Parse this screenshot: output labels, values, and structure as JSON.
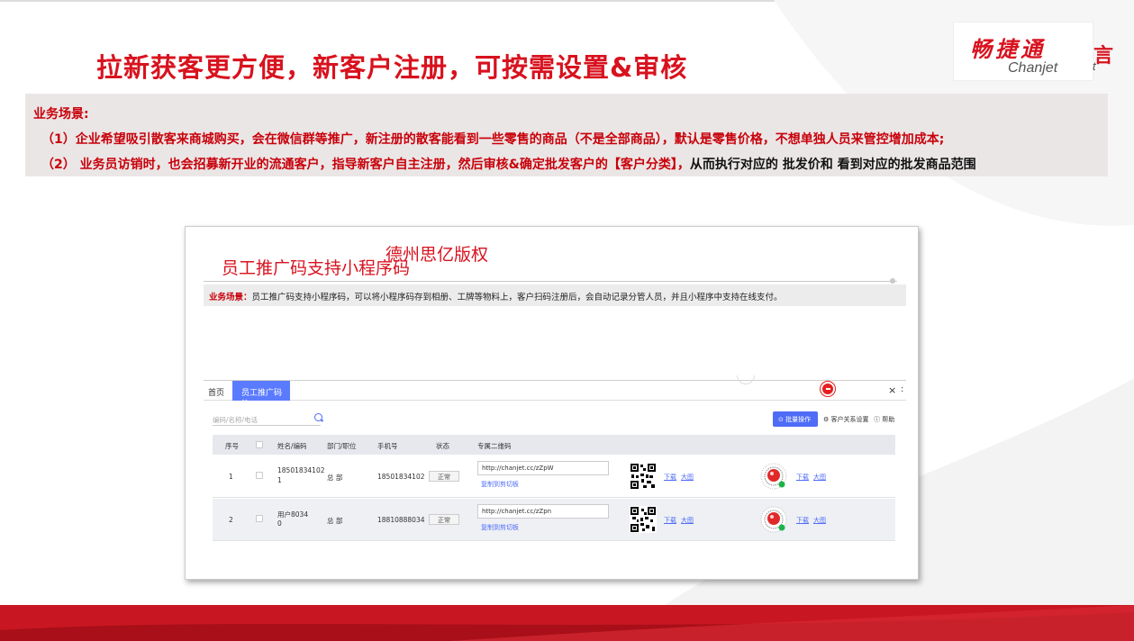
{
  "slide": {
    "title": "拉新获客更方便，新客户注册，可按需设置&审核",
    "colors": {
      "brand_red": "#d8121e",
      "scenario_bg": "#ebe6e6",
      "accent_blue": "#4f6cf7"
    }
  },
  "logo": {
    "cn": "畅捷通",
    "en": "Chanjet",
    "edge_cn": "言",
    "edge_en": "t"
  },
  "scenario": {
    "heading": "业务场景:",
    "line1": "（1）企业希望吸引散客来商城购买，会在微信群等推广，新注册的散客能看到一些零售的商品（不是全部商品），默认是零售价格，不想单独人员来管控增加成本;",
    "line2_red": "（2） 业务员访销时，也会招募新开业的流通客户，指导新客户自主注册，然后审核&确定批发客户的【客户分类】，",
    "line2_black": "从而执行对应的 批发价和 看到对应的批发商品范围"
  },
  "screenshot": {
    "title": "员工推广码支持小程序码",
    "watermark": "德州思亿版权",
    "bar_label": "业务场景：",
    "bar_text": "员工推广码支持小程序码，可以将小程序码存到相册、工牌等物料上，客户扫码注册后，会自动记录分管人员，并且小程序中支持在线支付。",
    "app": {
      "tabs": {
        "home": "首页",
        "active": "员工推广码 ×",
        "close": "×",
        "more": ":"
      },
      "search_placeholder": "编码/名称/电话",
      "batch_button": "批量操作",
      "relation_settings": "客户关系设置",
      "help": "帮助",
      "columns": [
        "序号",
        "",
        "姓名/编码",
        "部门/职位",
        "手机号",
        "状态",
        "专属二维码"
      ],
      "rows": [
        {
          "index": "1",
          "name_line1": "18501834102",
          "name_line2": "1",
          "dept": "总 部",
          "phone": "18501834102",
          "status": "正常",
          "url": "http://chanjet.cc/zZpW",
          "copy": "复制到剪切板",
          "qr_download": "下载",
          "qr_large": "大图",
          "mini_download": "下载",
          "mini_large": "大图"
        },
        {
          "index": "2",
          "name_line1": "用户8034",
          "name_line2": "0",
          "dept": "总 部",
          "phone": "18810888034",
          "status": "正常",
          "url": "http://chanjet.cc/zZpn",
          "copy": "复制到剪切板",
          "qr_download": "下载",
          "qr_large": "大图",
          "mini_download": "下载",
          "mini_large": "大图"
        }
      ]
    }
  }
}
